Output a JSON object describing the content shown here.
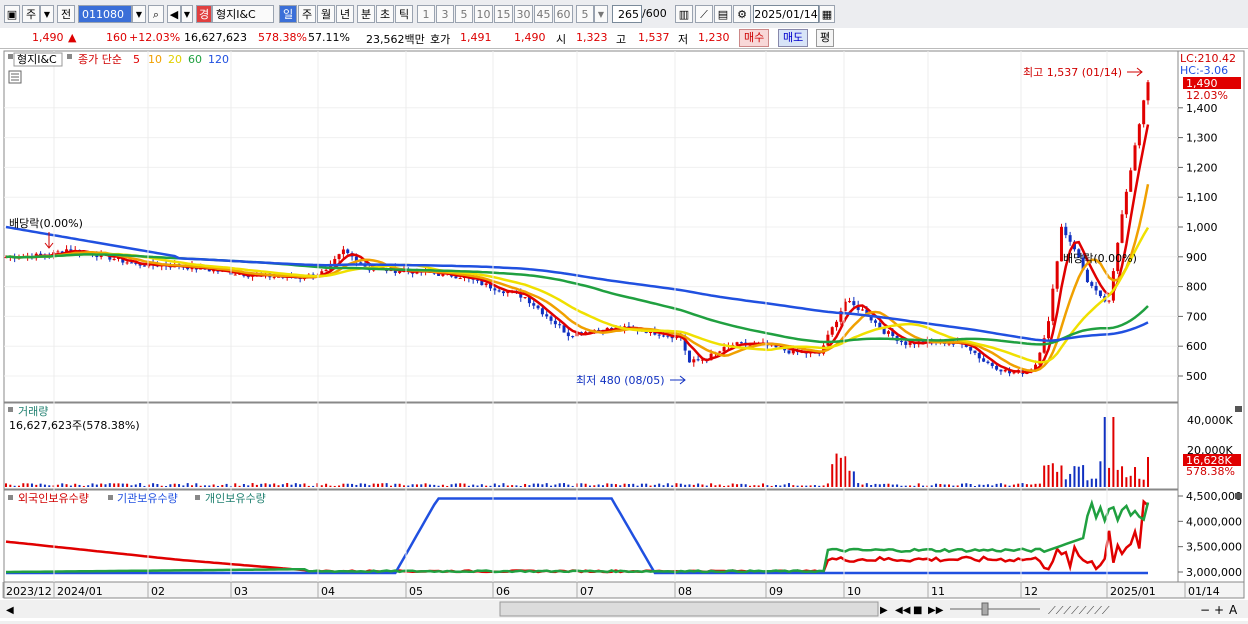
{
  "toolbar": {
    "period_a": "주",
    "prev": "전",
    "code": "011080",
    "market_badge": "경",
    "stock_name": "형지I&C",
    "periods": [
      "일",
      "주",
      "월",
      "년",
      "분",
      "초",
      "틱"
    ],
    "active_period": "일",
    "intervals": [
      "1",
      "3",
      "5",
      "10",
      "15",
      "30",
      "45",
      "60"
    ],
    "interval_value": "5",
    "count": "265",
    "count_max": "/600",
    "date": "2025/01/14"
  },
  "quote": {
    "price": "1,490",
    "change": "160",
    "change_pct": "+12.03%",
    "volume": "16,627,623",
    "vol_ratio": "578.38%",
    "turnover": "57.11%",
    "amount": "23,562백만",
    "ask_label": "호가",
    "ask": "1,491",
    "bid": "1,490",
    "open_label": "시",
    "open": "1,323",
    "high_label": "고",
    "high": "1,537",
    "low_label": "저",
    "low": "1,230",
    "buy": "매수",
    "sell": "매도",
    "avg": "평"
  },
  "price_panel": {
    "title": "형지I&C",
    "ma_label": "종가 단순",
    "ma_periods": [
      "5",
      "10",
      "20",
      "60",
      "120"
    ],
    "lc": "LC:210.42",
    "hc": "HC:-3.06",
    "current_price": "1,490",
    "current_pct": "12.03%",
    "high_note": "최고 1,537 (01/14)",
    "low_note": "최저 480 (08/05)",
    "dividend_note": "배당락(0.00%)",
    "dividend_note2": "배당락(0.00%)",
    "y_ticks": [
      "1,400",
      "1,300",
      "1,200",
      "1,100",
      "1,000",
      "900",
      "800",
      "700",
      "600",
      "500"
    ]
  },
  "volume_panel": {
    "title": "거래량",
    "info": "16,627,623주(578.38%)",
    "y_tick": "40,000K",
    "y_tick2": "20,000K",
    "current": "16,628K",
    "current_pct": "578.38%"
  },
  "holding_panel": {
    "series": [
      "외국인보유수량",
      "기관보유수량",
      "개인보유수량"
    ],
    "y_ticks": [
      "4,500,000",
      "4,000,000",
      "3,500,000",
      "3,000,000"
    ]
  },
  "x_axis": {
    "labels": [
      "2023/12",
      "2024/01",
      "02",
      "03",
      "04",
      "05",
      "06",
      "07",
      "08",
      "09",
      "10",
      "11",
      "12",
      "2025/01",
      "01/14"
    ]
  },
  "colors": {
    "ma5": "#e00000",
    "ma10": "#f0a000",
    "ma20": "#f0e000",
    "ma60": "#20a040",
    "ma120": "#2050e0",
    "foreign": "#e00000",
    "institution": "#2050e0",
    "individual": "#20a040"
  }
}
